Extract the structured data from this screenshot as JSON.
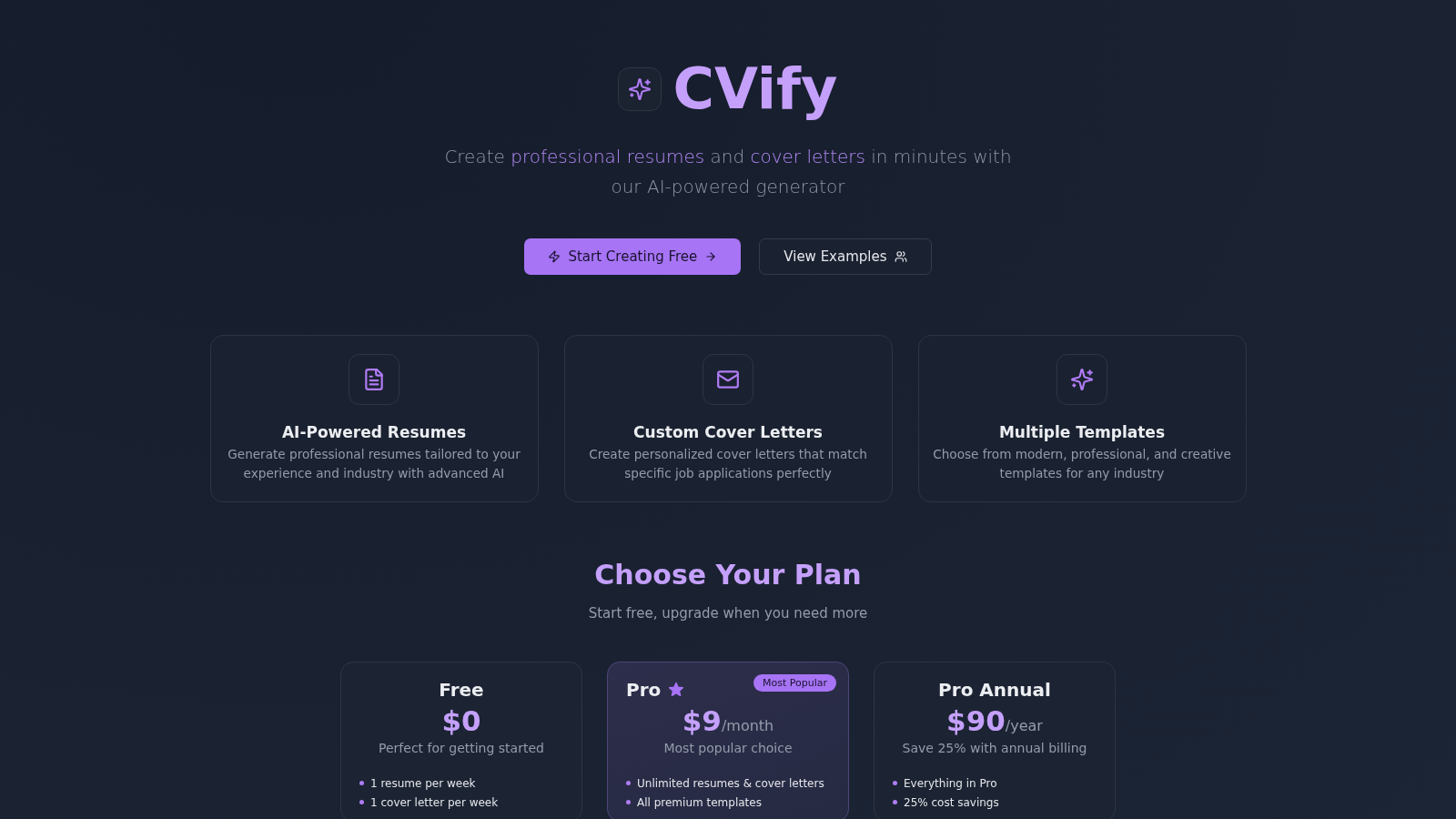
{
  "brand": {
    "name": "CVify"
  },
  "tagline": [
    {
      "text": "Create ",
      "highlight": false
    },
    {
      "text": "professional resumes",
      "highlight": true
    },
    {
      "text": " and ",
      "highlight": false
    },
    {
      "text": "cover letters",
      "highlight": true
    },
    {
      "text": " in minutes with our AI-powered generator",
      "highlight": false
    }
  ],
  "actions": [
    {
      "label": "Start Creating Free",
      "kind": "primary"
    },
    {
      "label": "View Examples",
      "kind": "secondary"
    }
  ],
  "features": [
    {
      "kind": "document",
      "title": "AI-Powered Resumes",
      "description": "Generate professional resumes tailored to your experience and industry with advanced AI"
    },
    {
      "kind": "mail",
      "title": "Custom Cover Letters",
      "description": "Create personalized cover letters that match specific job applications perfectly"
    },
    {
      "kind": "sparkles",
      "title": "Multiple Templates",
      "description": "Choose from modern, professional, and creative templates for any industry"
    }
  ],
  "pricing": {
    "title": "Choose Your Plan",
    "subtitle": "Start free, upgrade when you need more",
    "plans": [
      {
        "name": "Free",
        "price": "$0",
        "tagline": "Perfect for getting started",
        "featured": false,
        "features": [
          "1 resume per week",
          "1 cover letter per week"
        ]
      },
      {
        "name": "Pro",
        "price": "$9",
        "period": "/month",
        "badge": "Most Popular",
        "tagline": "Most popular choice",
        "featured": true,
        "features": [
          "Unlimited resumes & cover letters",
          "All premium templates"
        ]
      },
      {
        "name": "Pro Annual",
        "price": "$90",
        "period": "/year",
        "tagline": "Save 25% with annual billing",
        "featured": false,
        "features": [
          "Everything in Pro",
          "25% cost savings"
        ]
      }
    ]
  }
}
